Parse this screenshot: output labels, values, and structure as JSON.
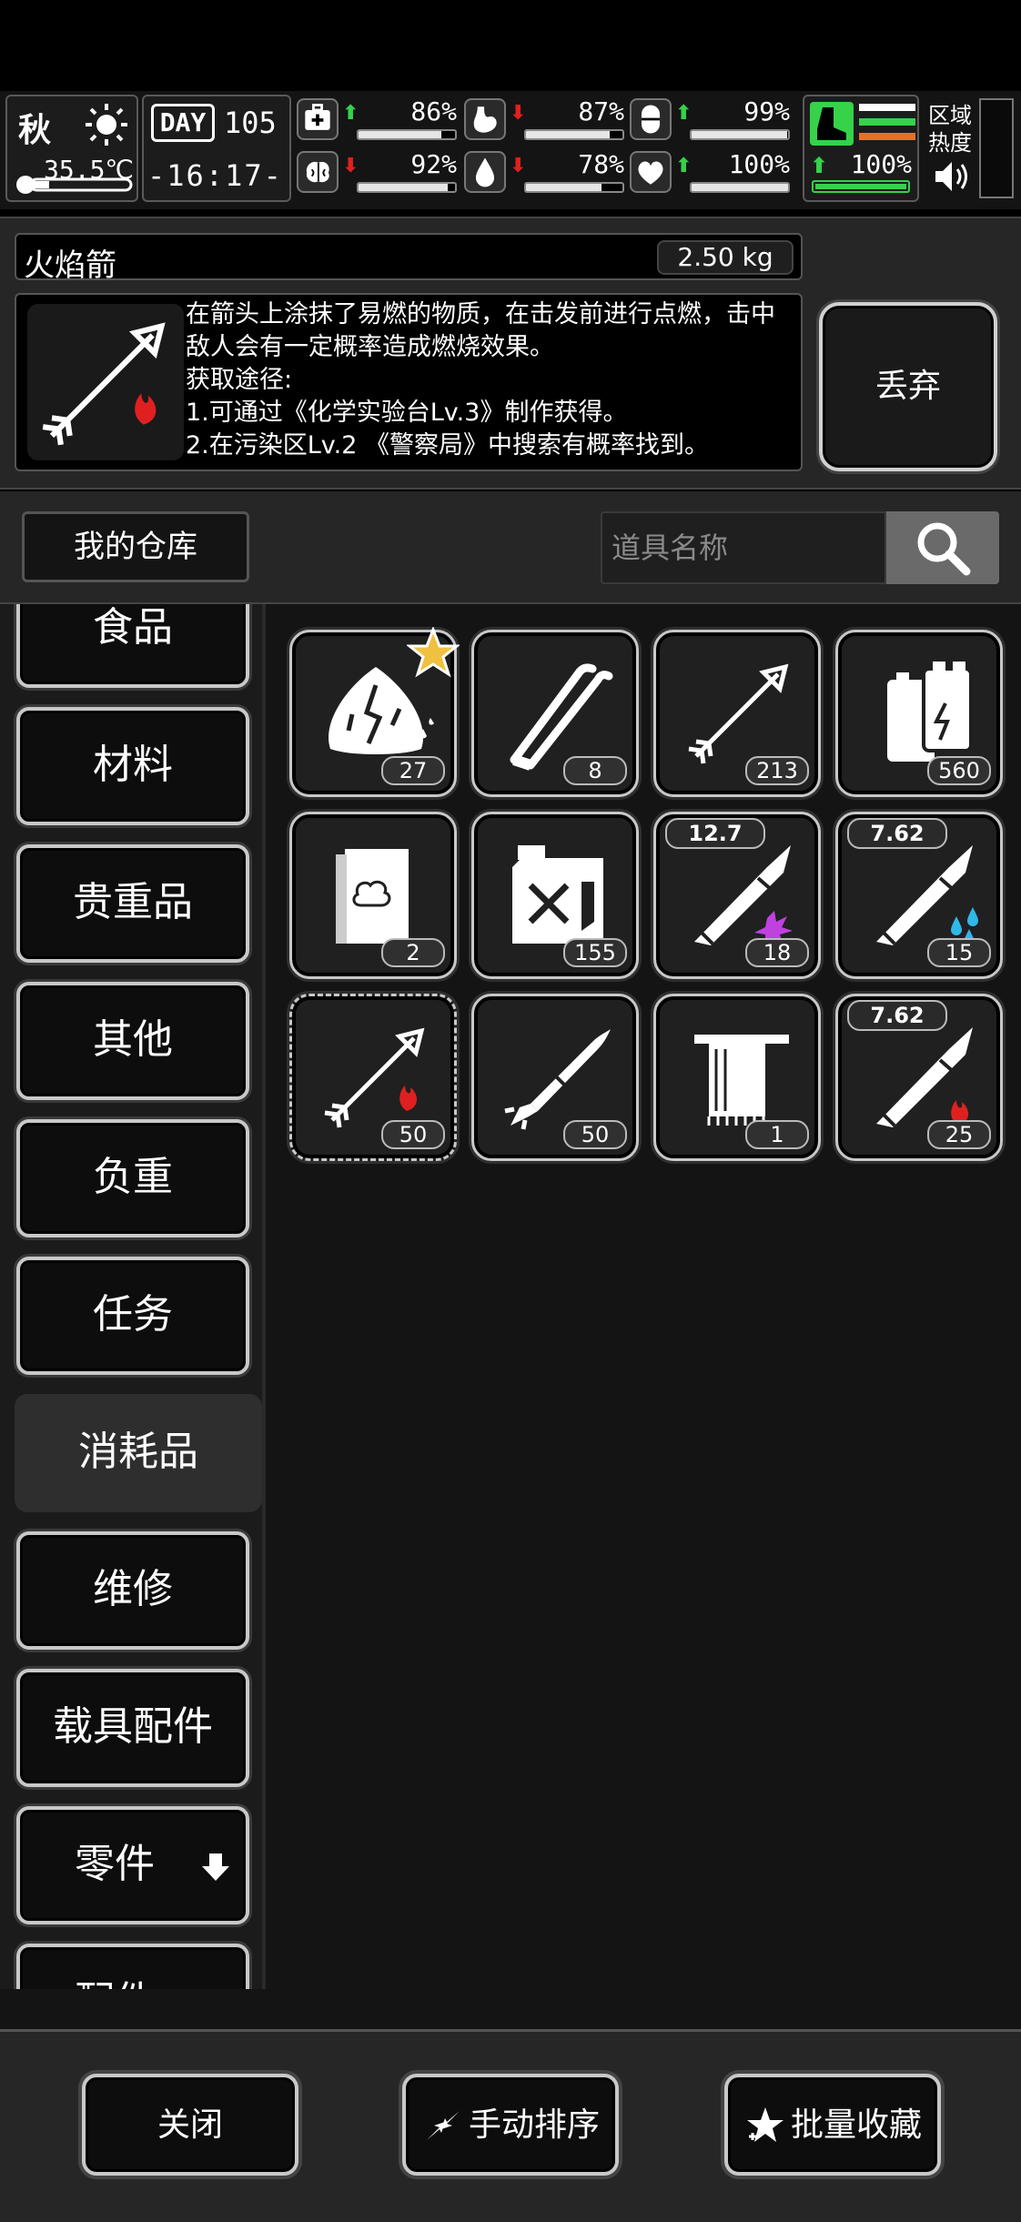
{
  "hud": {
    "season": "秋",
    "temperature": "35.5℃",
    "day_label": "DAY",
    "day_number": "105",
    "clock": "-16:17-",
    "stats": [
      {
        "name": "health",
        "icon": "medkit-icon",
        "trend": "up",
        "value": "86%",
        "level": 0.86
      },
      {
        "name": "hunger",
        "icon": "stomach-icon",
        "trend": "down",
        "value": "87%",
        "level": 0.87
      },
      {
        "name": "stamina",
        "icon": "pill-icon",
        "trend": "up",
        "value": "99%",
        "level": 0.99
      },
      {
        "name": "sanity",
        "icon": "brain-icon",
        "trend": "down",
        "value": "92%",
        "level": 0.92
      },
      {
        "name": "thirst",
        "icon": "water-drop-icon",
        "trend": "down",
        "value": "78%",
        "level": 0.78
      },
      {
        "name": "mood",
        "icon": "heart-icon",
        "trend": "up",
        "value": "100%",
        "level": 1.0
      }
    ],
    "boot_value": "100%",
    "region_heat_label": "区域热度"
  },
  "detail": {
    "name": "火焰箭",
    "weight": "2.50 kg",
    "description": "在箭头上涂抹了易燃的物质，在击发前进行点燃，击中敌人会有一定概率造成燃烧效果。\n获取途径:\n1.可通过《化学实验台Lv.3》制作获得。\n2.在污染区Lv.2 《警察局》中搜索有概率找到。",
    "discard_label": "丢弃"
  },
  "warehouse": {
    "title": "我的仓库",
    "search_placeholder": "道具名称"
  },
  "categories": [
    {
      "label": "食品",
      "active": false
    },
    {
      "label": "材料",
      "active": false
    },
    {
      "label": "贵重品",
      "active": false
    },
    {
      "label": "其他",
      "active": false
    },
    {
      "label": "负重",
      "active": false
    },
    {
      "label": "任务",
      "active": false
    },
    {
      "label": "消耗品",
      "active": true
    },
    {
      "label": "维修",
      "active": false
    },
    {
      "label": "载具配件",
      "active": false
    },
    {
      "label": "零件",
      "active": false,
      "has_arrow": true
    },
    {
      "label": "配件",
      "active": false,
      "has_arrow": true
    }
  ],
  "items": [
    {
      "icon": "cloth-rag-icon",
      "count": "27",
      "starred": true
    },
    {
      "icon": "tweezers-icon",
      "count": "8"
    },
    {
      "icon": "arrow-icon",
      "count": "213"
    },
    {
      "icon": "battery-icon",
      "count": "560"
    },
    {
      "icon": "book-icon",
      "count": "2"
    },
    {
      "icon": "fuel-can-icon",
      "count": "155"
    },
    {
      "icon": "bullet-icon",
      "count": "18",
      "caliber": "12.7",
      "effect": "purple-spark"
    },
    {
      "icon": "bullet-icon",
      "count": "15",
      "caliber": "7.62",
      "effect": "blue-drops"
    },
    {
      "icon": "fire-arrow-icon",
      "count": "50",
      "selected": true
    },
    {
      "icon": "rocket-icon",
      "count": "50"
    },
    {
      "icon": "towel-icon",
      "count": "1"
    },
    {
      "icon": "fire-bullet-icon",
      "count": "25",
      "caliber": "7.62"
    }
  ],
  "buttons": {
    "close": "关闭",
    "sort": "手动排序",
    "favorite": "批量收藏"
  },
  "colors": {
    "up": "#35d24a",
    "down": "#e02020",
    "boot": "#35d24a",
    "fire": "#e02020",
    "star": "#f0c040"
  }
}
